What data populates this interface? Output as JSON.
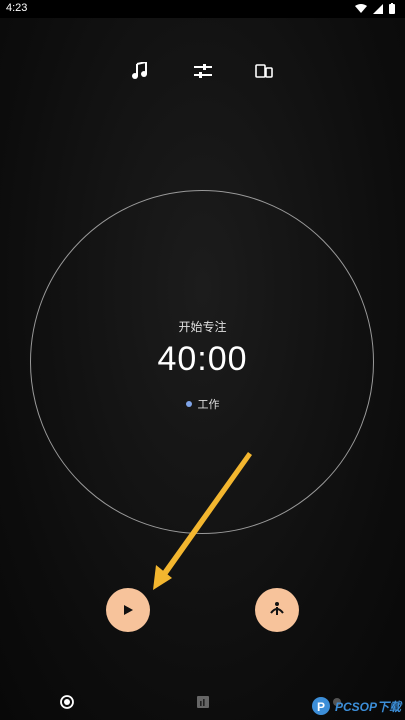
{
  "status_bar": {
    "time": "4:23",
    "icons": [
      "wifi-icon",
      "signal-icon",
      "battery-icon"
    ]
  },
  "toolbar": {
    "items": [
      "music-note-icon",
      "equalizer-sliders-icon",
      "devices-icon"
    ]
  },
  "focus": {
    "start_label": "开始专注",
    "timer": "40:00",
    "tag_label": "工作",
    "tag_color": "#7fa4e8"
  },
  "controls": {
    "play_icon": "play-icon",
    "secondary_icon": "meditation-icon",
    "button_color": "#f7c39b"
  },
  "bottom_nav": {
    "items": [
      "focus-radio-icon",
      "stats-chart-icon",
      "more-icon"
    ]
  },
  "watermark": {
    "text": "PCSOP下载"
  }
}
